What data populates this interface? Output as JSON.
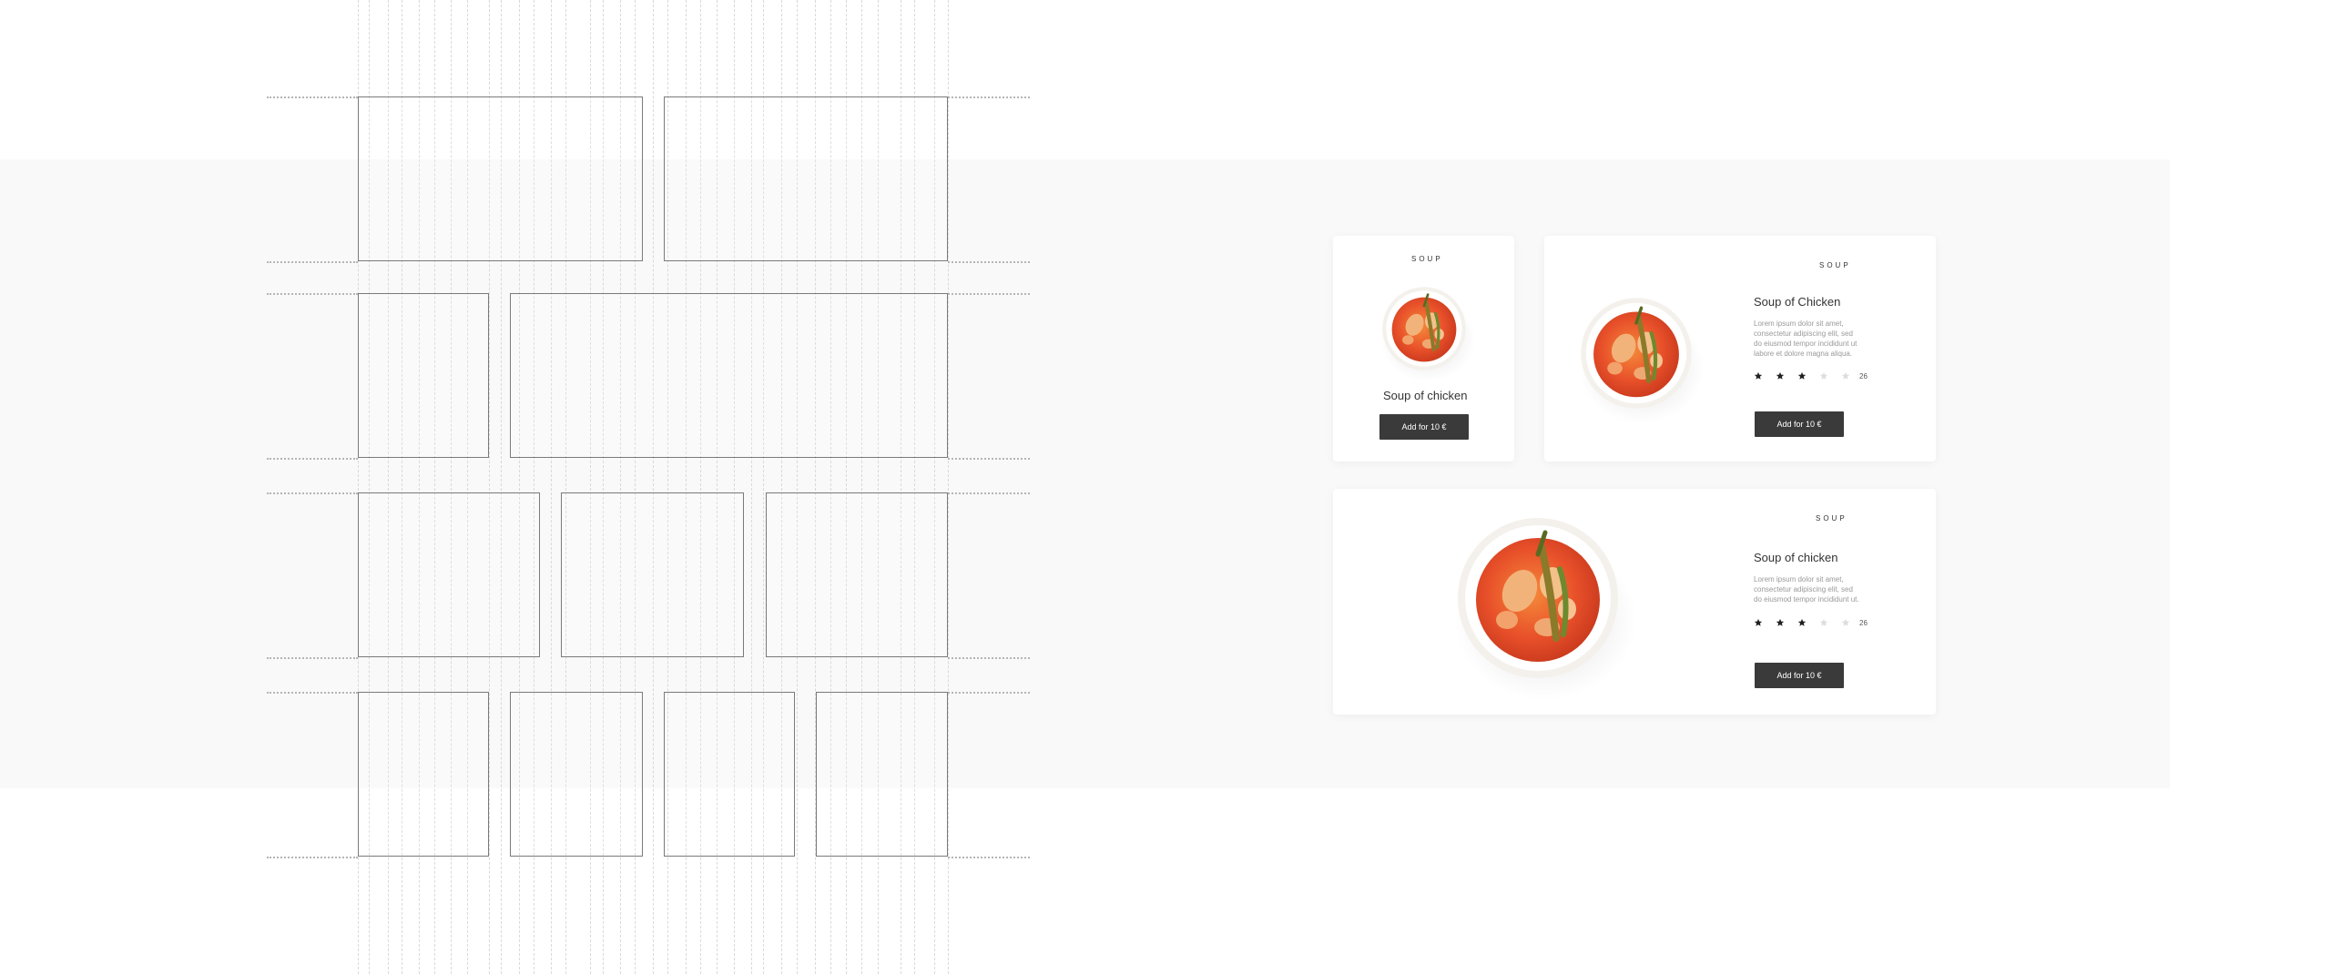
{
  "cards": {
    "small": {
      "category": "SOUP",
      "title": "Soup of chicken",
      "button_label": "Add for 10 €"
    },
    "wide": {
      "category": "SOUP",
      "title": "Soup of Chicken",
      "description": "Lorem ipsum dolor sit amet, consectetur adipiscing elit, sed do eiusmod tempor incididunt ut labore et dolore magna aliqua.",
      "rating": 3,
      "rating_max": 5,
      "review_count": "26",
      "button_label": "Add for 10 €"
    },
    "large": {
      "category": "SOUP",
      "title": "Soup of chicken",
      "description": "Lorem ipsum dolor sit amet, consectetur adipiscing elit, sed do eiusmod tempor incididunt ut.",
      "rating": 3,
      "rating_max": 5,
      "review_count": "26",
      "button_label": "Add for 10 €"
    }
  },
  "colors": {
    "button": "#3a3a3a",
    "star_filled": "#222222",
    "star_empty": "#dddddd",
    "soup": "#e8502a"
  },
  "icons": {
    "star": "star-icon",
    "food": "soup-bowl-image"
  }
}
